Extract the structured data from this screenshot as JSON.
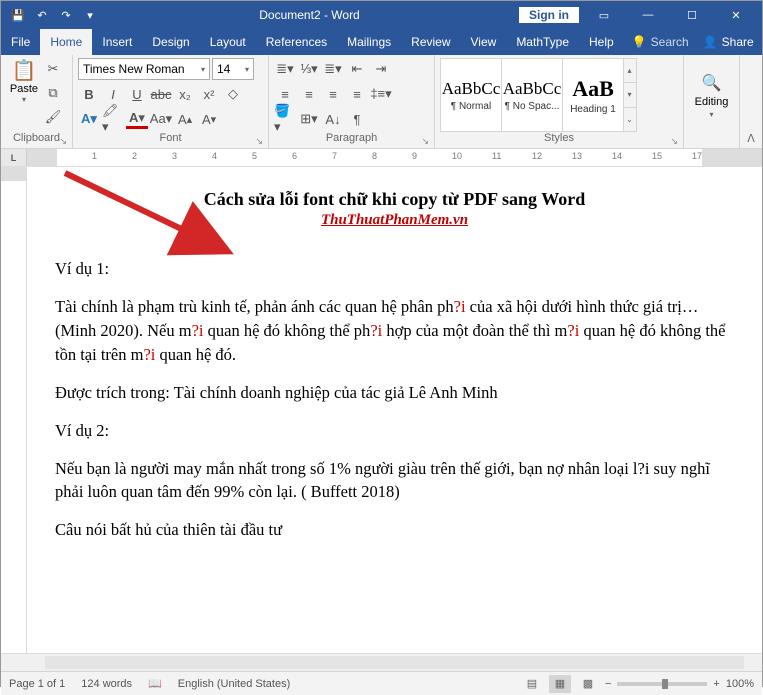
{
  "titlebar": {
    "title": "Document2 - Word",
    "signin": "Sign in"
  },
  "tabs": [
    "File",
    "Home",
    "Insert",
    "Design",
    "Layout",
    "References",
    "Mailings",
    "Review",
    "View",
    "MathType",
    "Help"
  ],
  "search_placeholder": "Search",
  "share": "Share",
  "ribbon": {
    "clipboard": {
      "label": "Clipboard",
      "paste": "Paste"
    },
    "font": {
      "label": "Font",
      "name": "Times New Roman",
      "size": "14"
    },
    "paragraph": {
      "label": "Paragraph"
    },
    "styles": {
      "label": "Styles",
      "items": [
        {
          "sample": "AaBbCc",
          "name": "¶ Normal"
        },
        {
          "sample": "AaBbCc",
          "name": "¶ No Spac..."
        },
        {
          "sample": "AaB",
          "name": "Heading 1"
        }
      ]
    },
    "editing": {
      "label": "Editing"
    }
  },
  "document": {
    "title": "Cách sửa lỗi font chữ khi copy từ PDF sang Word",
    "subtitle": "ThuThuatPhanMem.vn",
    "p_vd1": "Ví dụ 1:",
    "p1a": "Tài chính là phạm trù kinh tế, phản ánh các quan hệ phân ph",
    "p1a_err": "?i",
    "p1b": " của xã hội dưới hình thức giá trị… (Minh 2020). Nếu m",
    "p1b_err": "?i",
    "p1c": " quan hệ đó không thể ph",
    "p1c_err": "?i",
    "p1d": " hợp của một đoàn thể thì m",
    "p1d_err": "?i",
    "p1e": " quan hệ đó không thể tồn tại trên m",
    "p1e_err": "?i",
    "p1f": " quan hệ đó.",
    "p2": "Được trích trong: Tài chính doanh nghiệp của tác giả Lê Anh Minh",
    "p_vd2": "Ví dụ 2:",
    "p3": "Nếu bạn là người may mắn nhất trong số 1% người giàu trên thế giới, bạn nợ nhân loại l?i suy nghĩ phải luôn quan tâm đến 99% còn lại. ( Buffett 2018)",
    "p4": "Câu nói bất hủ của thiên tài đầu tư"
  },
  "statusbar": {
    "page": "Page 1 of 1",
    "words": "124 words",
    "lang": "English (United States)",
    "zoom": "100%"
  }
}
